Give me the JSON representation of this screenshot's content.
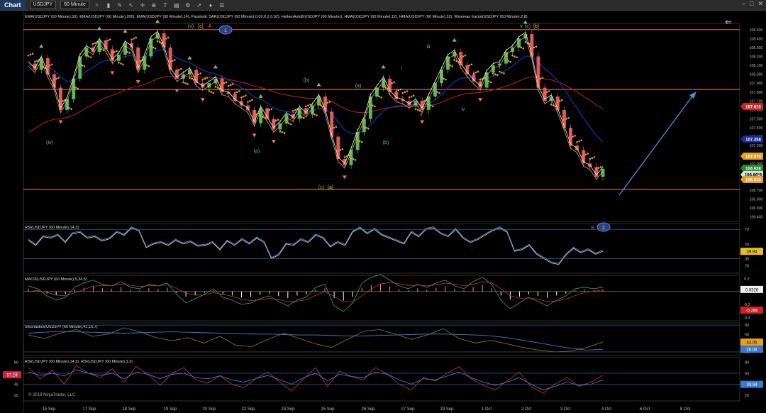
{
  "toolbar": {
    "title": "Chart",
    "instrument": "USDJPY",
    "timeframe": "60 Minute",
    "icons": [
      "search-icon",
      "bar-type-icon",
      "draw-icon",
      "pointer-icon",
      "crosshair-icon",
      "zoom-icon",
      "text-icon",
      "data-box-icon",
      "properties-icon",
      "arrow-icon",
      "strategy-icon",
      "list-icon"
    ]
  },
  "window": {
    "minimize": "–",
    "maximize": "□",
    "close": "✕"
  },
  "indicator_header": "EMA(USDJPY (60 Minute),50), EMA(USDJPY (60 Minute),200), EMA(USDJPY (60 Minute),14), Parabolic SAR(USDJPY (60 Minute),0.02,0.2,0.02), HeikenAshi8(USDJPY (60 Minute)), HMA(USDJPY (60 Minute),12), HMA(USDJPY (60 Minute),32), Wiseman fractal(USDJPY (60 Minute),2,8)",
  "copyright": "© 2019 NinjaTrader, LLC",
  "colors": {
    "bull": "#66cc66",
    "bear": "#ff6666",
    "sar": "#e6a020",
    "ema200": "#b01e1e",
    "ema50": "#1a2a9a",
    "level": "#ff7777",
    "arrow": "#4a90d9"
  },
  "chart_data": [
    {
      "type": "line",
      "name": "price",
      "ylim": [
        106.35,
        108.57
      ],
      "price_ticks": [
        "108.500",
        "108.400",
        "108.300",
        "108.200",
        "108.100",
        "108.000",
        "107.900",
        "107.800",
        "107.700",
        "107.600",
        "107.500",
        "107.400",
        "107.300",
        "107.200",
        "107.100",
        "107.000",
        "106.900",
        "106.800",
        "106.700",
        "106.600",
        "106.500",
        "106.400"
      ],
      "x_labels": [
        "15 Sep",
        "17 Sep",
        "18 Sep",
        "19 Sep",
        "20 Sep",
        "22 Sep",
        "24 Sep",
        "25 Sep",
        "26 Sep",
        "27 Sep",
        "29 Sep",
        "1 Oct",
        "2 Oct",
        "3 Oct",
        "4 Oct",
        "6 Oct",
        "8 Oct"
      ],
      "close": [
        108.12,
        108.05,
        108.18,
        108.0,
        107.85,
        107.6,
        107.72,
        107.95,
        108.2,
        108.3,
        108.25,
        108.38,
        108.28,
        108.15,
        108.22,
        108.35,
        108.3,
        108.05,
        108.2,
        108.4,
        108.46,
        108.3,
        108.05,
        107.95,
        108.0,
        108.05,
        107.9,
        107.85,
        107.9,
        107.95,
        107.8,
        107.78,
        107.7,
        107.65,
        107.6,
        107.45,
        107.62,
        107.5,
        107.38,
        107.45,
        107.55,
        107.5,
        107.62,
        107.55,
        107.65,
        107.75,
        107.58,
        107.3,
        107.05,
        106.98,
        107.15,
        107.35,
        107.5,
        107.75,
        107.85,
        107.95,
        107.8,
        107.72,
        107.7,
        107.65,
        107.7,
        107.6,
        107.75,
        107.9,
        108.05,
        108.2,
        108.25,
        108.1,
        108.0,
        107.92,
        107.85,
        108.02,
        108.1,
        108.12,
        108.25,
        108.3,
        108.4,
        108.45,
        108.2,
        107.85,
        107.7,
        107.75,
        107.6,
        107.4,
        107.2,
        107.15,
        107.0,
        106.96,
        106.85,
        106.94
      ],
      "levels": [
        {
          "value": 108.5,
          "label": ""
        },
        {
          "value": 107.83,
          "label": ""
        },
        {
          "value": 106.71,
          "label": ""
        }
      ],
      "price_badges": [
        {
          "value": 107.61,
          "label": "107.610",
          "color": "#cc2222"
        },
        {
          "value": 107.258,
          "label": "107.258",
          "color": "#1a2a9a"
        },
        {
          "value": 107.074,
          "label": "107.074",
          "color": "#e6a020"
        },
        {
          "value": 106.938,
          "label": "106.938",
          "color": "#2a8a2a"
        },
        {
          "value": 106.869,
          "label": "106.86°9",
          "color": "#dddddd"
        },
        {
          "value": 106.83,
          "label": "106.830",
          "color": "#e6a020"
        }
      ],
      "wave_labels": [
        {
          "text": "(iv)",
          "color": "#66cc66"
        },
        {
          "text": "(v)",
          "color": "#66cc66"
        },
        {
          "text": "[c]",
          "color": "#e6c020"
        },
        {
          "text": "A",
          "color": "#ff5555"
        },
        {
          "text": "1",
          "color": "#6688ff"
        },
        {
          "text": "(a)",
          "color": "#66cc66"
        },
        {
          "text": "(b)",
          "color": "#66cc66"
        },
        {
          "text": "(c)",
          "color": "#66cc66"
        },
        {
          "text": "[a]",
          "color": "#e6c020"
        },
        {
          "text": "(a)",
          "color": "#66cc66"
        },
        {
          "text": "(b)",
          "color": "#66cc66"
        },
        {
          "text": "i",
          "color": "#66cc66"
        },
        {
          "text": "ii",
          "color": "#55aaff"
        },
        {
          "text": "iii",
          "color": "#66cc66"
        },
        {
          "text": "iv",
          "color": "#55aaff"
        },
        {
          "text": "v",
          "color": "#66cc66"
        },
        {
          "text": "(c)",
          "color": "#66cc66"
        },
        {
          "text": "[b]",
          "color": "#e6c020"
        },
        {
          "text": "B",
          "color": "#ff5555"
        },
        {
          "text": "2",
          "color": "#6688ff"
        }
      ]
    },
    {
      "type": "line",
      "name": "rsi",
      "title": "RSI(USDJPY (60 Minute),14,3)",
      "ylim": [
        10,
        78
      ],
      "ticks": [
        "70",
        "50",
        "40",
        "30",
        "20"
      ],
      "last": "39.94",
      "values": [
        55,
        48,
        60,
        58,
        62,
        52,
        64,
        66,
        58,
        60,
        54,
        57,
        66,
        62,
        72,
        68,
        45,
        50,
        52,
        48,
        55,
        50,
        53,
        47,
        48,
        52,
        42,
        54,
        48,
        56,
        50,
        58,
        52,
        30,
        35,
        50,
        48,
        56,
        52,
        62,
        58,
        46,
        52,
        48,
        66,
        72,
        64,
        70,
        62,
        58,
        54,
        50,
        66,
        60,
        70,
        72,
        64,
        60,
        70,
        58,
        52,
        56,
        62,
        68,
        72,
        66,
        40,
        42,
        48,
        36,
        30,
        24,
        22,
        35,
        44,
        38,
        42,
        36,
        40
      ]
    },
    {
      "type": "bar",
      "name": "macd",
      "title": "MACD(USDJPY (60 Minute),5,34,5)",
      "ylim": [
        -0.45,
        0.25
      ],
      "ticks": [
        "0.2",
        "-0.2",
        "-0.4"
      ],
      "last_macd": "0.0326",
      "last_signal": "-0.286",
      "values": [
        0.04,
        0.02,
        -0.03,
        -0.06,
        -0.04,
        0.03,
        0.06,
        0.08,
        0.05,
        0.04,
        0.07,
        0.03,
        0.02,
        0.05,
        0.04,
        0.06,
        -0.02,
        -0.08,
        -0.05,
        -0.02,
        0.02,
        -0.04,
        -0.06,
        -0.09,
        -0.08,
        -0.05,
        -0.03,
        -0.07,
        -0.1,
        -0.06,
        -0.04,
        0.03,
        0.05,
        -0.1,
        -0.14,
        -0.08,
        0.06,
        0.1,
        0.12,
        0.08,
        0.04,
        0.02,
        0.05,
        0.03,
        0.06,
        0.08,
        0.04,
        0.02,
        0.07,
        0.1,
        0.05,
        -0.06,
        -0.12,
        -0.08,
        -0.04,
        -0.07,
        -0.1,
        -0.06,
        -0.03,
        0.02,
        0.03,
        0.02,
        0.03
      ]
    },
    {
      "type": "line",
      "name": "stochastics",
      "title": "Stochastics(USDJPY (60 Minute),42,16,7)",
      "ylim": [
        12,
        85
      ],
      "ticks": [
        "80",
        "60",
        "40",
        "20"
      ],
      "last_d": "42.05",
      "last_k": "26.08",
      "d_values": [
        62,
        64,
        66,
        65,
        64,
        63,
        62,
        63,
        64,
        65,
        64,
        63,
        62,
        61,
        60,
        60,
        59,
        58,
        58,
        57,
        56,
        56,
        57,
        58,
        59,
        60,
        60,
        59,
        58,
        56,
        52,
        46,
        40,
        34,
        28,
        24,
        26
      ],
      "k_values": [
        58,
        50,
        62,
        70,
        55,
        60,
        74,
        65,
        52,
        45,
        52,
        40,
        55,
        35,
        32,
        48,
        62,
        50,
        38,
        30,
        48,
        66,
        70,
        60,
        48,
        58,
        72,
        50,
        40,
        46,
        38,
        30,
        24,
        20,
        22,
        30,
        42
      ]
    },
    {
      "type": "line",
      "name": "rsi_dual",
      "title": "RSI(USDJPY (60 Minute),14,3), RSI(USDJPY (60 Minute),3,3)",
      "ylim": [
        10,
        88
      ],
      "ticks": [
        "80",
        "60",
        "40",
        "20"
      ],
      "left_badge": "57.14",
      "last": "39.94",
      "fast_values": [
        70,
        50,
        65,
        40,
        74,
        60,
        52,
        68,
        44,
        72,
        58,
        38,
        60,
        70,
        48,
        42,
        56,
        40,
        34,
        50,
        62,
        44,
        28,
        50,
        70,
        36,
        64,
        54,
        48,
        70,
        58,
        40,
        30,
        52,
        46,
        60,
        72,
        50,
        38,
        30,
        46,
        62,
        36,
        24,
        40,
        52,
        36,
        44,
        56
      ],
      "slow_values": [
        62,
        56,
        60,
        55,
        66,
        60,
        56,
        60,
        50,
        62,
        58,
        50,
        58,
        60,
        52,
        50,
        55,
        48,
        44,
        50,
        56,
        48,
        40,
        52,
        60,
        46,
        58,
        54,
        52,
        62,
        58,
        48,
        40,
        50,
        48,
        55,
        62,
        52,
        44,
        38,
        44,
        52,
        40,
        30,
        36,
        44,
        38,
        40,
        48
      ]
    }
  ]
}
